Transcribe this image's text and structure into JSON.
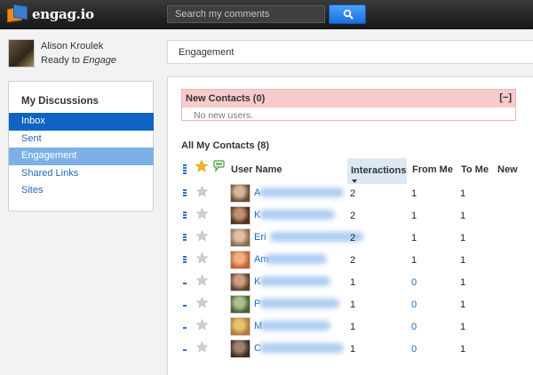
{
  "app": {
    "name": "engag.io"
  },
  "search": {
    "placeholder": "Search my comments"
  },
  "user": {
    "name": "Alison Kroulek",
    "status_prefix": "Ready to",
    "status_emphasis": "Engage"
  },
  "sidebar": {
    "title": "My Discussions",
    "items": [
      {
        "label": "Inbox"
      },
      {
        "label": "Sent"
      },
      {
        "label": "Engagement"
      },
      {
        "label": "Shared Links"
      },
      {
        "label": "Sites"
      }
    ]
  },
  "header": {
    "title": "Engagement"
  },
  "new_contacts": {
    "title": "New Contacts (0)",
    "toggle": "[−]",
    "empty_text": "No new users."
  },
  "contacts": {
    "title": "All My Contacts (8)",
    "columns": {
      "user_name": "User Name",
      "interactions": "Interactions",
      "from_me": "From Me",
      "to_me": "To Me",
      "new": "New"
    },
    "rows": [
      {
        "name_visible": "A",
        "interactions": "2",
        "from_me": "1",
        "to_me": "1",
        "thumb_colors": [
          "#6b4a30",
          "#d8b89a"
        ]
      },
      {
        "name_visible": "K",
        "interactions": "2",
        "from_me": "1",
        "to_me": "1",
        "thumb_colors": [
          "#4a3020",
          "#c09070"
        ]
      },
      {
        "name_visible": "Eri",
        "interactions": "2",
        "from_me": "1",
        "to_me": "1",
        "thumb_colors": [
          "#8a6a50",
          "#e0c0a0"
        ]
      },
      {
        "name_visible": "Am",
        "interactions": "2",
        "from_me": "1",
        "to_me": "1",
        "thumb_colors": [
          "#c06030",
          "#f0b080"
        ]
      },
      {
        "name_visible": "K",
        "interactions": "1",
        "from_me": "0",
        "to_me": "1",
        "thumb_colors": [
          "#5a4030",
          "#d0a080"
        ]
      },
      {
        "name_visible": "P",
        "interactions": "1",
        "from_me": "0",
        "to_me": "1",
        "thumb_colors": [
          "#4a6030",
          "#b0c090"
        ]
      },
      {
        "name_visible": "M",
        "interactions": "1",
        "from_me": "0",
        "to_me": "1",
        "thumb_colors": [
          "#b07a30",
          "#e8c070"
        ]
      },
      {
        "name_visible": "C",
        "interactions": "1",
        "from_me": "0",
        "to_me": "1",
        "thumb_colors": [
          "#3a2a20",
          "#a08070"
        ]
      }
    ]
  },
  "colors": {
    "accent": "#0f63c4",
    "link": "#1f68b8",
    "new_contacts_bg": "#f8caca",
    "star_gold": "#f3b813"
  }
}
